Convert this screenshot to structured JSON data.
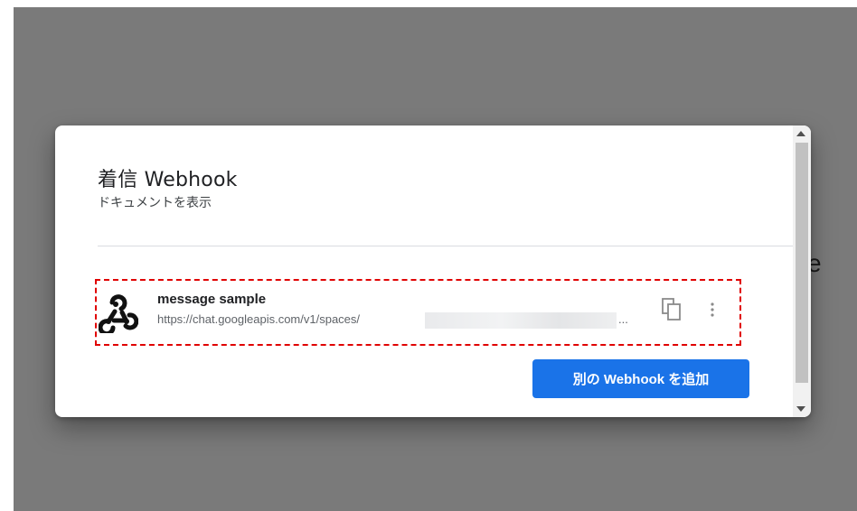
{
  "background": {
    "partial_text": "e"
  },
  "dialog": {
    "title": "着信 Webhook",
    "doc_link": "ドキュメントを表示",
    "webhook": {
      "name": "message sample",
      "url": "https://chat.googleapis.com/v1/spaces/",
      "url_ellipsis": "...",
      "icon": "webhook-icon"
    },
    "copy_icon": "copy-icon",
    "more_icon": "more-vert-icon",
    "add_button_label": "別の Webhook を追加"
  },
  "colors": {
    "accent": "#1a73e8",
    "highlight_border": "#e00000",
    "backdrop": "#7a7a7a"
  }
}
